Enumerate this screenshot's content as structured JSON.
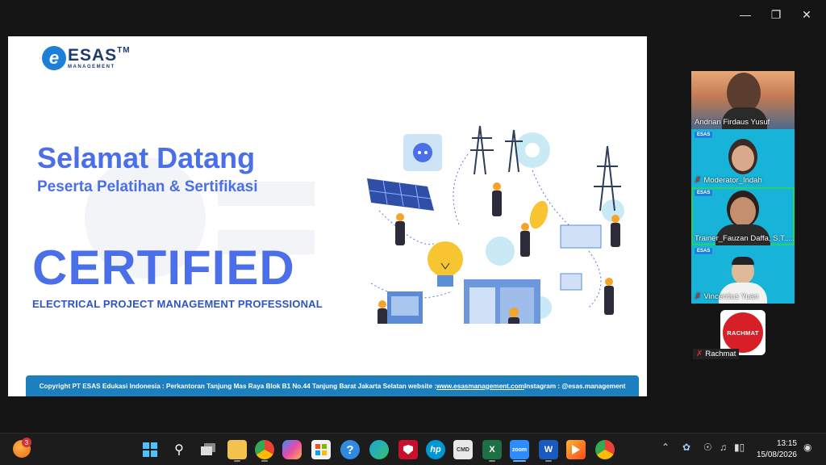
{
  "window": {
    "minimize_icon": "minimize-icon",
    "restore_icon": "restore-icon",
    "close_icon": "close-icon"
  },
  "slide": {
    "logo_letter": "e",
    "logo_brand": "ESAS",
    "logo_tm": "TM",
    "logo_sub": "MANAGEMENT",
    "title": "Selamat Datang",
    "subtitle": "Peserta Pelatihan & Sertifikasi",
    "certified": "CERTIFIED",
    "program": "ELECTRICAL PROJECT MANAGEMENT PROFESSIONAL",
    "footer_prefix": "Copyright PT ESAS Edukasi Indonesia : Perkantoran Tanjung Mas Raya Blok B1 No.44 Tanjung Barat Jakarta Selatan website : ",
    "footer_link": "www.esasmanagement.com",
    "footer_suffix": " Instagram : @esas.management",
    "colors": {
      "heading": "#4a6fe8",
      "footer": "#1b7fc0"
    }
  },
  "participants": [
    {
      "name": "Andrian Firdaus Yusuf",
      "muted": false
    },
    {
      "name": "Moderator_Indah",
      "muted": true
    },
    {
      "name": "Trainer_Fauzan Daffa, S.T.,...",
      "muted": false,
      "active": true
    },
    {
      "name": "Vincentius Yuan",
      "muted": true
    },
    {
      "name": "Rachmat",
      "muted": true,
      "avatar_text": "RACHMAT"
    }
  ],
  "tile_logo": "ESAS",
  "taskbar": {
    "notification_count": "3",
    "time": "13:15",
    "date": "15/08/2026",
    "apps": [
      "start-icon",
      "search-icon",
      "task-view-icon",
      "file-explorer-icon",
      "chrome-icon",
      "copilot-icon",
      "store-icon",
      "help-icon",
      "edge-icon",
      "mcafee-icon",
      "hp-icon",
      "cmd-icon",
      "excel-icon",
      "zoom-icon",
      "word-icon",
      "media-player-icon",
      "chrome-alt-icon"
    ],
    "zoom_label": "zoom",
    "word_label": "W",
    "excel_label": "X",
    "hp_label": "hp",
    "help_label": "?",
    "cmd_label": "CMD"
  }
}
